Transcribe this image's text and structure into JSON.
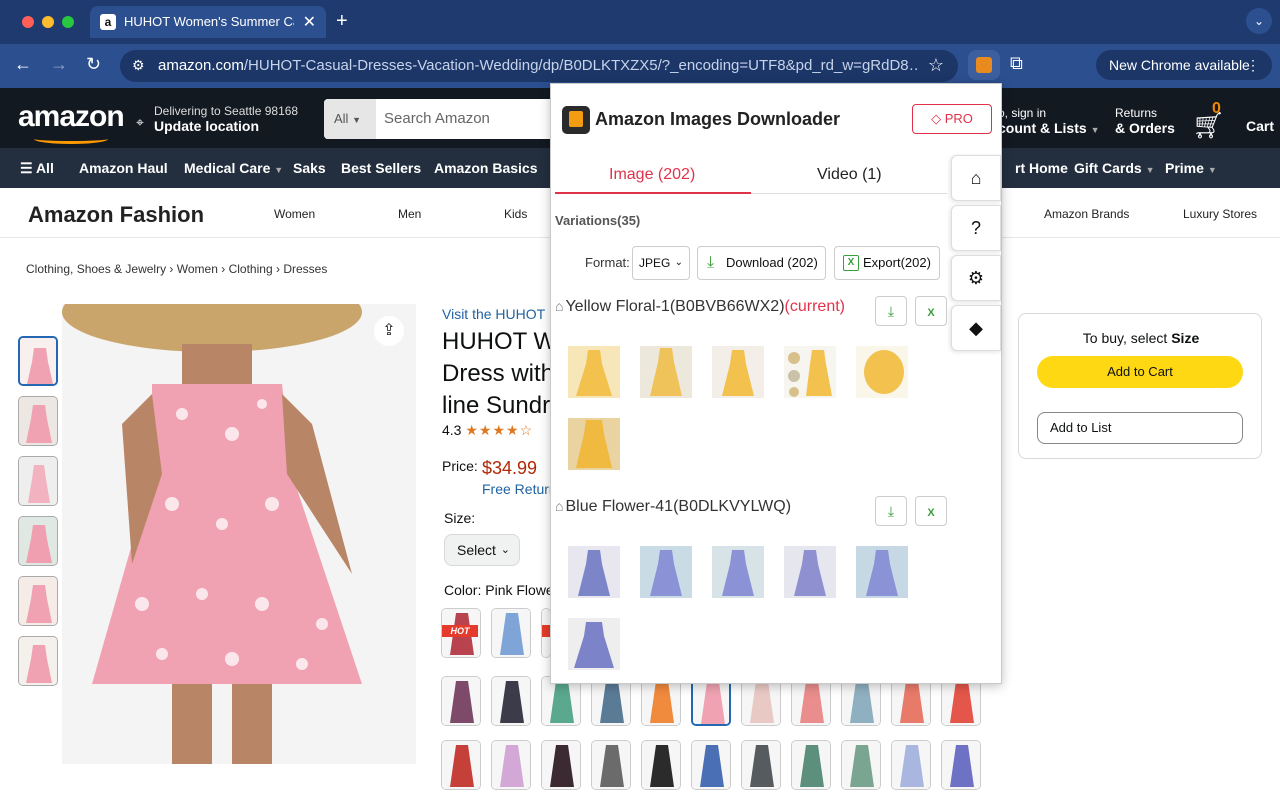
{
  "browser": {
    "tab_title": "HUHOT Women's Summer Ca",
    "tab_close": "✕",
    "new_tab": "+",
    "url_domain": "amazon.com",
    "url_path": "/HUHOT-Casual-Dresses-Vacation-Wedding/dp/B0DLKTXZX5/?_encoding=UTF8&pd_rd_w=gRdD8…",
    "new_chrome": "New Chrome available",
    "new_chrome_menu": "⋮"
  },
  "amazon_header": {
    "logo": "amazon",
    "deliver_line1": "Delivering to Seattle 98168",
    "deliver_line2": "Update location",
    "search_scope": "All",
    "search_placeholder": "Search Amazon",
    "signin_line1": "o, sign in",
    "signin_line2": "count & Lists",
    "returns_line1": "Returns",
    "returns_line2": "& Orders",
    "cart_count": "0",
    "cart_label": "Cart"
  },
  "amazon_nav": {
    "items": [
      "All",
      "Amazon Haul",
      "Medical Care",
      "Saks",
      "Best Sellers",
      "Amazon Basics",
      "rt Home",
      "Gift Cards",
      "Prime"
    ]
  },
  "fashion_bar": {
    "title": "Amazon Fashion",
    "items": [
      "Women",
      "Men",
      "Kids",
      "Amazon Brands",
      "Luxury Stores"
    ]
  },
  "breadcrumb": [
    "Clothing, Shoes & Jewelry",
    "Women",
    "Clothing",
    "Dresses"
  ],
  "product": {
    "visit": "Visit the HUHOT",
    "title_lines": [
      "HUHOT W",
      "Dress with",
      "line Sundr"
    ],
    "rating": "4.3",
    "rating_stars": "★★★★☆",
    "price_label": "Price:",
    "price": "$34.99",
    "free_returns": "Free Return",
    "size_label": "Size:",
    "size_select": "Select",
    "color_label": "Color:",
    "color_value": "Pink Flowe",
    "hot_badge": "HOT"
  },
  "buy_box": {
    "prompt_prefix": "To buy, select ",
    "prompt_bold": "Size",
    "add_to_cart": "Add to Cart",
    "add_to_list": "Add to List"
  },
  "extension": {
    "title": "Amazon Images Downloader",
    "pro_label": "PRO",
    "tab_image": "Image (202)",
    "tab_video": "Video (1)",
    "variations": "Variations(35)",
    "format_label": "Format:",
    "format_value": "JPEG",
    "download_all": "Download (202)",
    "export_all": "Export(202)",
    "groups": [
      {
        "name": "Yellow Floral-1(B0BVB66WX2)",
        "current": "(current)",
        "image_count": 6
      },
      {
        "name": "Blue Flower-41(B0DLKVYLWQ)",
        "current": "",
        "image_count": 6
      }
    ]
  },
  "colors": {
    "amazon_dark": "#131921",
    "amazon_nav": "#232f3e",
    "chrome_blue": "#2c4f8f",
    "accent_red": "#e0334a",
    "price_red": "#b12704",
    "cart_yellow": "#ffd814",
    "dress_pink": "#f0a2b2",
    "floral_yellow": "#f2c14e",
    "floral_blue": "#8b93d6"
  }
}
